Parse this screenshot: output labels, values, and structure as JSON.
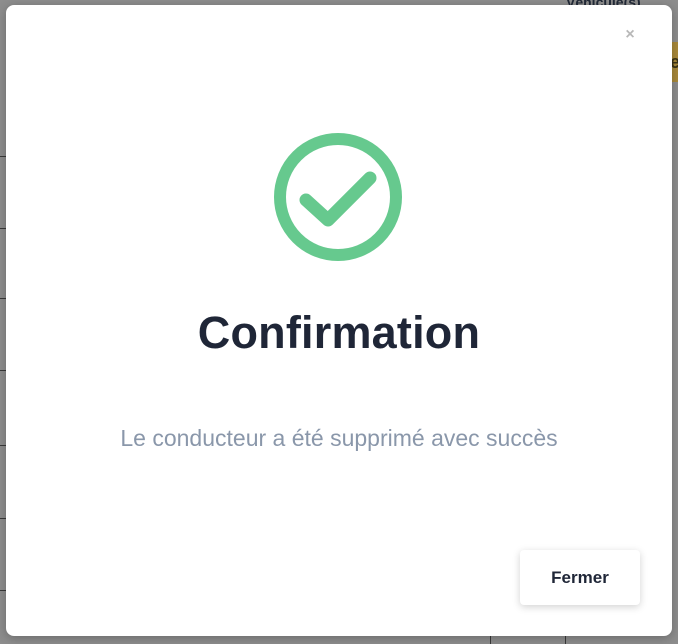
{
  "background": {
    "header_text": "Véhicule(s)",
    "tab_fragment": "e"
  },
  "modal": {
    "close_icon": "×",
    "icon_name": "check-circle-icon",
    "icon_color": "#66c98e",
    "title": "Confirmation",
    "message": "Le conducteur a été supprimé avec succès",
    "close_button_label": "Fermer"
  }
}
